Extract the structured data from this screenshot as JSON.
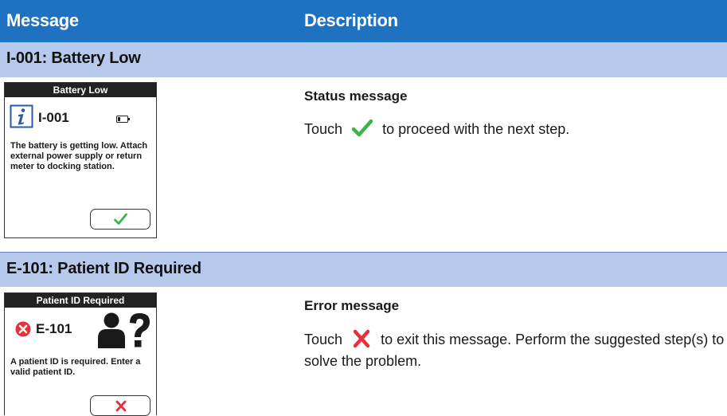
{
  "header": {
    "message_label": "Message",
    "description_label": "Description"
  },
  "sections": [
    {
      "title": "I-001: Battery Low",
      "screen": {
        "title": "Battery Low",
        "code": "I-001",
        "text": "The battery is getting low. Attach external power supply or return meter to docking station."
      },
      "description": {
        "heading": "Status message",
        "text_before": "Touch",
        "text_after": "to proceed with the next step."
      }
    },
    {
      "title": "E-101: Patient ID Required",
      "screen": {
        "title": "Patient ID Required",
        "code": "E-101",
        "text": "A patient ID is required. Enter a valid patient ID."
      },
      "description": {
        "heading": "Error message",
        "text_before": "Touch",
        "text_after": "to exit this message. Perform the suggested step(s) to solve the problem."
      }
    }
  ],
  "colors": {
    "header": "#1f72c1",
    "band": "#b7c9ea",
    "check": "#3bb54a",
    "cross": "#e8303a"
  },
  "icons": [
    "info-icon",
    "battery-icon",
    "check-icon",
    "error-icon",
    "patient-question-icon",
    "cross-icon"
  ]
}
